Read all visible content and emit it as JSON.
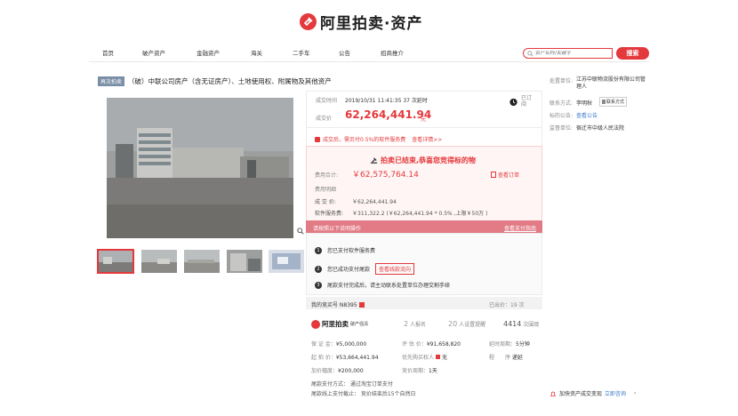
{
  "brand": {
    "name": "阿里拍卖·资产",
    "color": "#e4393c"
  },
  "nav": {
    "items": [
      "首页",
      "破产资产",
      "金融资产",
      "海关",
      "二手车",
      "公告",
      "招商推介"
    ],
    "search_placeholder": "资产名称/关键字",
    "search_label": "搜索"
  },
  "item": {
    "tag": "再次拍卖",
    "title": "（破）中联公司房产（含无证房产）、土地使用权、附属物及其他资产"
  },
  "deal": {
    "time_label": "成交时间",
    "time_value": "2019/10/31 11:41:35  37 次延时",
    "price_label": "成交价",
    "price_value": "62,264,441.94",
    "price_unit": "元",
    "subscribe_label": "已订阅",
    "service_note": "成交后，需另付0.5%的软件服务费",
    "service_link": "查看详情>>"
  },
  "result": {
    "banner": "拍卖已结束,恭喜您竞得标的物",
    "total_label": "费用合计:",
    "total_value": "￥62,575,764.14",
    "order_link": "查看订单",
    "detail_label": "费用明细",
    "deal_price_label": "成 交 价:",
    "deal_price_value": "￥62,264,441.94",
    "fee_label": "软件服务费:",
    "fee_value": "￥311,322.2 (￥62,264,441.94 * 0.5% ,上限￥50万 )"
  },
  "steps": {
    "header": "请按照以下说明操作",
    "header_link": "查看支付指南",
    "items": [
      {
        "num": "1",
        "text": "您已支付软件服务费",
        "action": ""
      },
      {
        "num": "2",
        "text": "您已成功支付尾款",
        "action": "查看线款流向"
      },
      {
        "num": "3",
        "text": "尾款支付完成后，请主动联系处置单位办理交割手续",
        "action": ""
      }
    ]
  },
  "bid": {
    "number_label": "我的竞买号 N8395",
    "bid_count": "已出价：19 次"
  },
  "stats": {
    "platform": "阿里拍卖",
    "platform_sub": "破产强清",
    "signups": "2",
    "signups_label": "人报名",
    "reminders": "20",
    "reminders_label": "人设置提醒",
    "views": "4414",
    "views_label": "次围观"
  },
  "terms": {
    "deposit_label": "保 证 金：",
    "deposit": "¥5,000,000",
    "start_label": "起 拍 价：",
    "start": "¥53,664,441.94",
    "increment_label": "加价幅度：",
    "increment": "¥200,000",
    "eval_label": "评 估 价：",
    "eval": "¥91,658,820",
    "priority_label": "优先购买权人",
    "priority_value": "无",
    "cycle_label": "竞价周期：",
    "cycle": "1天",
    "delay_label": "延时周期：",
    "delay": "5分钟",
    "procedure_label": "程　　序",
    "procedure": "递延",
    "pay_method": "尾款支付方式：  通过淘宝订单支付",
    "pay_deadline": "尾款线上支付截止：  竞价结束后15个自然日"
  },
  "seller": {
    "unit_label": "处置单位:",
    "unit": "江苏中联物流股份有限公司管理人",
    "contact_label": "联系方式:",
    "contact": "李明秋",
    "contact_tag": "联系方式",
    "notice_label": "标的公告:",
    "notice": "查看公告",
    "supervisor_label": "监督单位:",
    "supervisor": "宿迁市中级人民法院"
  },
  "footer": {
    "cta": "加快资产成交变现",
    "cta_link": "立即咨询"
  }
}
